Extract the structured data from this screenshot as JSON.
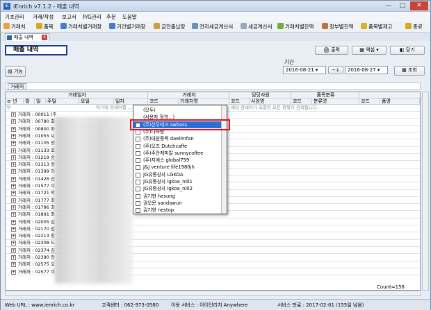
{
  "window": {
    "title": "iEnrich v7.1.2 - 매출 내역",
    "buttons": [
      "—",
      "□",
      "✕"
    ]
  },
  "menu": [
    "기초관리",
    "거래/작성",
    "보고서",
    "P/G관리",
    "주문",
    "도움말"
  ],
  "toolbar": [
    "거래처",
    "품목",
    "거래처별거래장",
    "기간별거래장",
    "금전출납장",
    "전자세금계산서",
    "세금계산서",
    "거래처별잔액",
    "창부별잔액",
    "품목별재고",
    "종료"
  ],
  "doctab": {
    "label": "매출 내역"
  },
  "page": {
    "title": "매출 내역",
    "print": "출력",
    "excel": "엑셀",
    "close": "닫기",
    "func": "기능",
    "search": "조회",
    "period_label": "기간",
    "date_from": "2016-08-21",
    "tilde": "~↓",
    "date_to": "2016-08-27",
    "group_label": "거래처"
  },
  "grid": {
    "group_headers": [
      "거래일자",
      "거래처",
      "담당사원",
      "품목분류"
    ],
    "headers": [
      "년",
      "월",
      "일",
      "주일",
      "요일",
      "일자",
      "코드",
      "거래처명",
      "코드",
      "사원명",
      "코드",
      "분류명",
      "코드",
      "품명"
    ],
    "filter_hint": "여기에 검색어를 ...",
    "filter_hint_right": "해당 검색어가 포함된 모든 항목이 검색됩니다.",
    "rows": [
      "거래처 : 00011 (주",
      "거래처 : 00780 회",
      "거래처 : 00800 파",
      "거래처 : 01055 오",
      "거래처 : 01105 엉",
      "거래처 : 01133 조",
      "거래처 : 01219 송",
      "거래처 : 01313 정",
      "거래처 : 01399 이",
      "거래처 : 01426 선",
      "거래처 : 01577 이",
      "거래처 : 01721 박",
      "거래처 : 01777 최",
      "거래처 : 01786 최",
      "거래처 : 01891 최",
      "거래처 : 02005 김",
      "거래처 : 02170 엄",
      "거래처 : 02213 창",
      "거래처 : 02308 드",
      "거래처 : 02374 김",
      "거래처 : 02390 장",
      "거래처 : 02575 오",
      "거래처 : 02577 이"
    ],
    "count": "Count=158"
  },
  "dropdown": {
    "items": [
      "(모두)",
      "(사용자 정의...)",
      "(주)산우테크 swboss",
      "(주)다사랑",
      "(주)대원통력 daelimfan",
      "(주)오즈 Dutchcaffe",
      "(주)주안케미칼 sunnycoffee",
      "(주)지에스 global759",
      "J&J venture life1980jh",
      "JG유통상사 LGKOA",
      "JG유통상사 lgkoa_nl01",
      "JG유통상사 lgkoa_nl02",
      "권기현 hesung",
      "권오문 sandawun",
      "김기현 nestop"
    ],
    "selected_index": 2
  },
  "status": {
    "url": "Web URL : www.ienrich.co.kr",
    "center": "고객센터 : 062-973-0580",
    "service": "이용 서비스 : 아이인리치 Anywhere",
    "expire": "서비스 만료 : 2017-02-01 (155일 남음)"
  }
}
